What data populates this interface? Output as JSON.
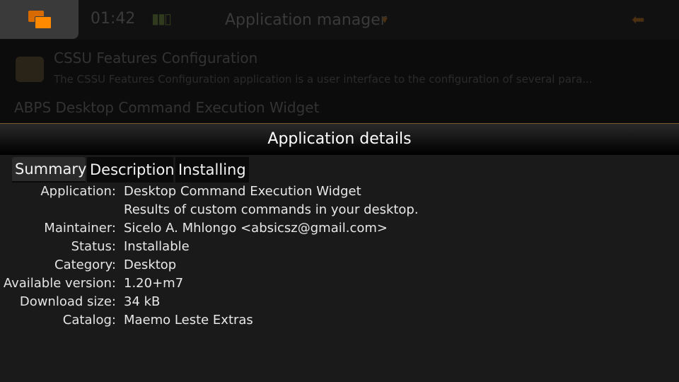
{
  "background_app": {
    "clock": "01:42",
    "title": "Application manager",
    "row1_title": "CSSU Features Configuration",
    "row1_subtitle": "The CSSU Features Configuration application is a user interface to the configuration of several para...",
    "row2_title": "ABPS Desktop Command Execution Widget"
  },
  "dialog": {
    "title": "Application details",
    "tabs": [
      {
        "label": "Summary",
        "active": true
      },
      {
        "label": "Description",
        "active": false
      },
      {
        "label": "Installing",
        "active": false
      }
    ],
    "fields": [
      {
        "label": "Application:",
        "value": "Desktop Command Execution Widget"
      },
      {
        "label": "",
        "value": "Results of custom commands in your desktop."
      },
      {
        "label": "Maintainer:",
        "value": "Sicelo A. Mhlongo <absicsz@gmail.com>"
      },
      {
        "label": "Status:",
        "value": "Installable"
      },
      {
        "label": "Category:",
        "value": "Desktop"
      },
      {
        "label": "Available version:",
        "value": "1.20+m7"
      },
      {
        "label": "Download size:",
        "value": "34 kB"
      },
      {
        "label": "Catalog:",
        "value": "Maemo Leste Extras"
      }
    ]
  },
  "colors": {
    "accent_orange": "#ff8a00",
    "background": "#1b1b1b"
  },
  "icons": {
    "task_switcher": "task-switcher-icon",
    "back": "back-arrow-icon"
  }
}
